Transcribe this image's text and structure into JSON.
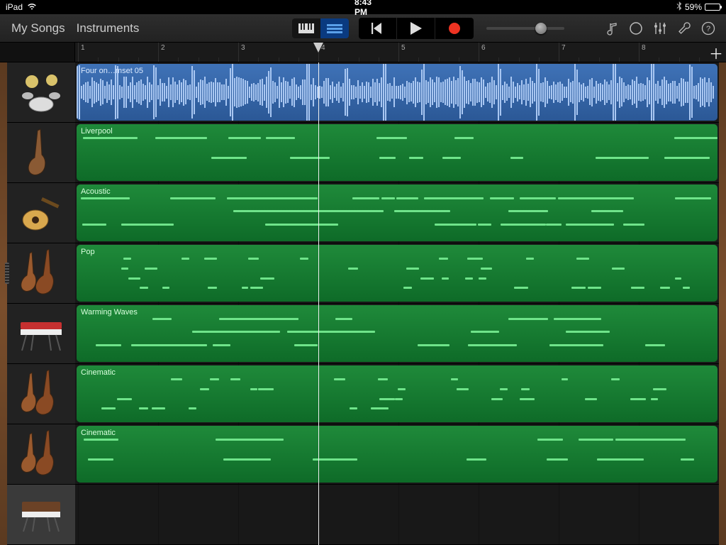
{
  "status": {
    "device": "iPad",
    "time": "8:43 PM",
    "battery_pct": "59%",
    "battery_fill": 59
  },
  "nav": {
    "my_songs": "My Songs",
    "instruments": "Instruments"
  },
  "ruler": {
    "bars": [
      "1",
      "2",
      "3",
      "4",
      "5",
      "6",
      "7",
      "8"
    ],
    "playhead_bar": 4
  },
  "volume": {
    "position_pct": 70
  },
  "tracks": [
    {
      "kind": "audio",
      "name": "Four on…mset 05",
      "instrument": "drums",
      "color": "blue"
    },
    {
      "kind": "midi",
      "name": "Liverpool",
      "instrument": "bass",
      "color": "green",
      "density": 0.1,
      "rows": 2
    },
    {
      "kind": "midi",
      "name": "Acoustic",
      "instrument": "guitar",
      "color": "green",
      "density": 0.35,
      "rows": 3
    },
    {
      "kind": "midi",
      "name": "Pop",
      "instrument": "strings",
      "color": "green",
      "density": 0.22,
      "rows": 4,
      "short": true
    },
    {
      "kind": "midi",
      "name": "Warming Waves",
      "instrument": "keys",
      "color": "green",
      "density": 0.18,
      "rows": 3
    },
    {
      "kind": "midi",
      "name": "Cinematic",
      "instrument": "strings",
      "color": "green",
      "density": 0.2,
      "rows": 4,
      "short": true
    },
    {
      "kind": "midi",
      "name": "Cinematic",
      "instrument": "strings",
      "color": "green",
      "density": 0.08,
      "rows": 2
    }
  ],
  "extra_header": {
    "instrument": "synth"
  },
  "colors": {
    "blue": "#2b5896",
    "green": "#0e6b28",
    "note": "#6fe48a",
    "wave": "#a9c7f2"
  }
}
